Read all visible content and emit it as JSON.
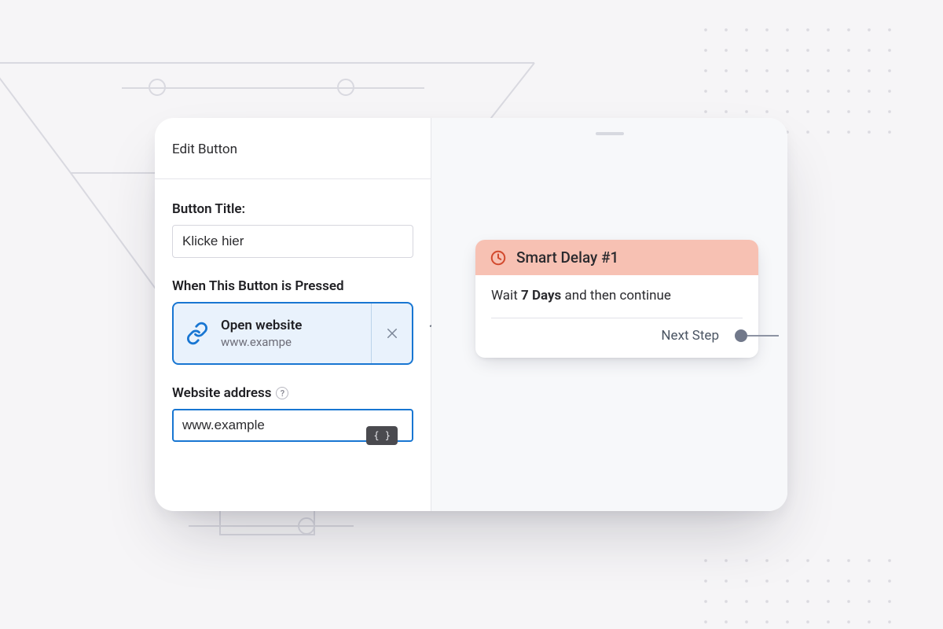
{
  "editor": {
    "panel_title": "Edit Button",
    "button_title": {
      "label": "Button Title:",
      "value": "Klicke hier"
    },
    "when_pressed": {
      "label": "When This Button is Pressed",
      "action": {
        "title": "Open website",
        "subtitle": "www.exampe"
      }
    },
    "website_address": {
      "label": "Website address",
      "value": "www.example"
    },
    "variable_chip": "{ }"
  },
  "flow": {
    "node": {
      "title": "Smart Delay #1",
      "wait_prefix": "Wait ",
      "wait_value": "7 Days",
      "wait_suffix": " and then continue",
      "next_step_label": "Next Step"
    }
  }
}
